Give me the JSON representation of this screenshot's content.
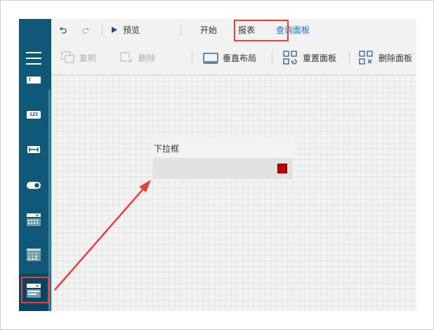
{
  "toolbar1": {
    "preview_label": "预览",
    "tabs": [
      {
        "label": "开始"
      },
      {
        "label": "报表"
      },
      {
        "label": "查询面板"
      }
    ]
  },
  "toolbar2": {
    "copy_label": "复制",
    "delete_label": "删除",
    "vertical_layout_label": "垂直布局",
    "reset_panel_label": "重置面板",
    "delete_panel_label": "删除面板"
  },
  "sidebar": {
    "items": [
      {
        "label": "I",
        "icon": "text-input-icon"
      },
      {
        "label": "123",
        "icon": "number-input-icon"
      },
      {
        "icon": "range-icon"
      },
      {
        "icon": "toggle-icon"
      },
      {
        "icon": "date-picker-icon"
      },
      {
        "icon": "date-range-icon"
      },
      {
        "icon": "dropdown-icon"
      }
    ]
  },
  "canvas": {
    "widget_label": "下拉框"
  },
  "colors": {
    "sidebar": "#0f5878",
    "accent": "#1a73c8",
    "highlight": "#e8413d",
    "widget_button": "#c00000"
  }
}
